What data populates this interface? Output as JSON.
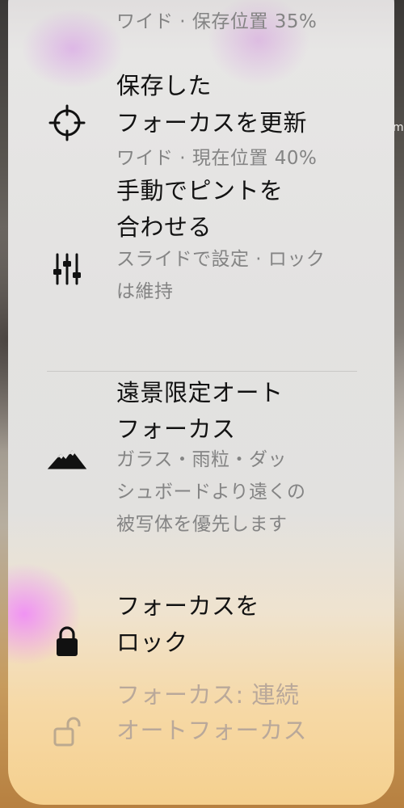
{
  "menu": {
    "top_partial_sub": "ワイド · 保存位置 35%",
    "items": [
      {
        "title_line1": "保存した",
        "title_line2": "フォーカスを更新",
        "sub_line1": "ワイド · 現在位置 40%",
        "icon": "crosshair-icon"
      },
      {
        "title_line1": "手動でピントを",
        "title_line2": "合わせる",
        "sub_line1": "スライドで設定 · ロック",
        "sub_line2": "は維持",
        "icon": "sliders-icon"
      },
      {
        "title_line1": "遠景限定オート",
        "title_line2": "フォーカス",
        "sub_line1": "ガラス・雨粒・ダッ",
        "sub_line2": "シュボードより遠くの",
        "sub_line3": "被写体を優先します",
        "icon": "mountains-icon"
      },
      {
        "title_line1": "フォーカスを",
        "title_line2": "ロック",
        "icon": "lock-icon"
      },
      {
        "title_line1": "フォーカス: 連続",
        "title_line2": "オートフォーカス",
        "icon": "unlock-icon"
      }
    ]
  },
  "background": {
    "edge_text": "m"
  }
}
